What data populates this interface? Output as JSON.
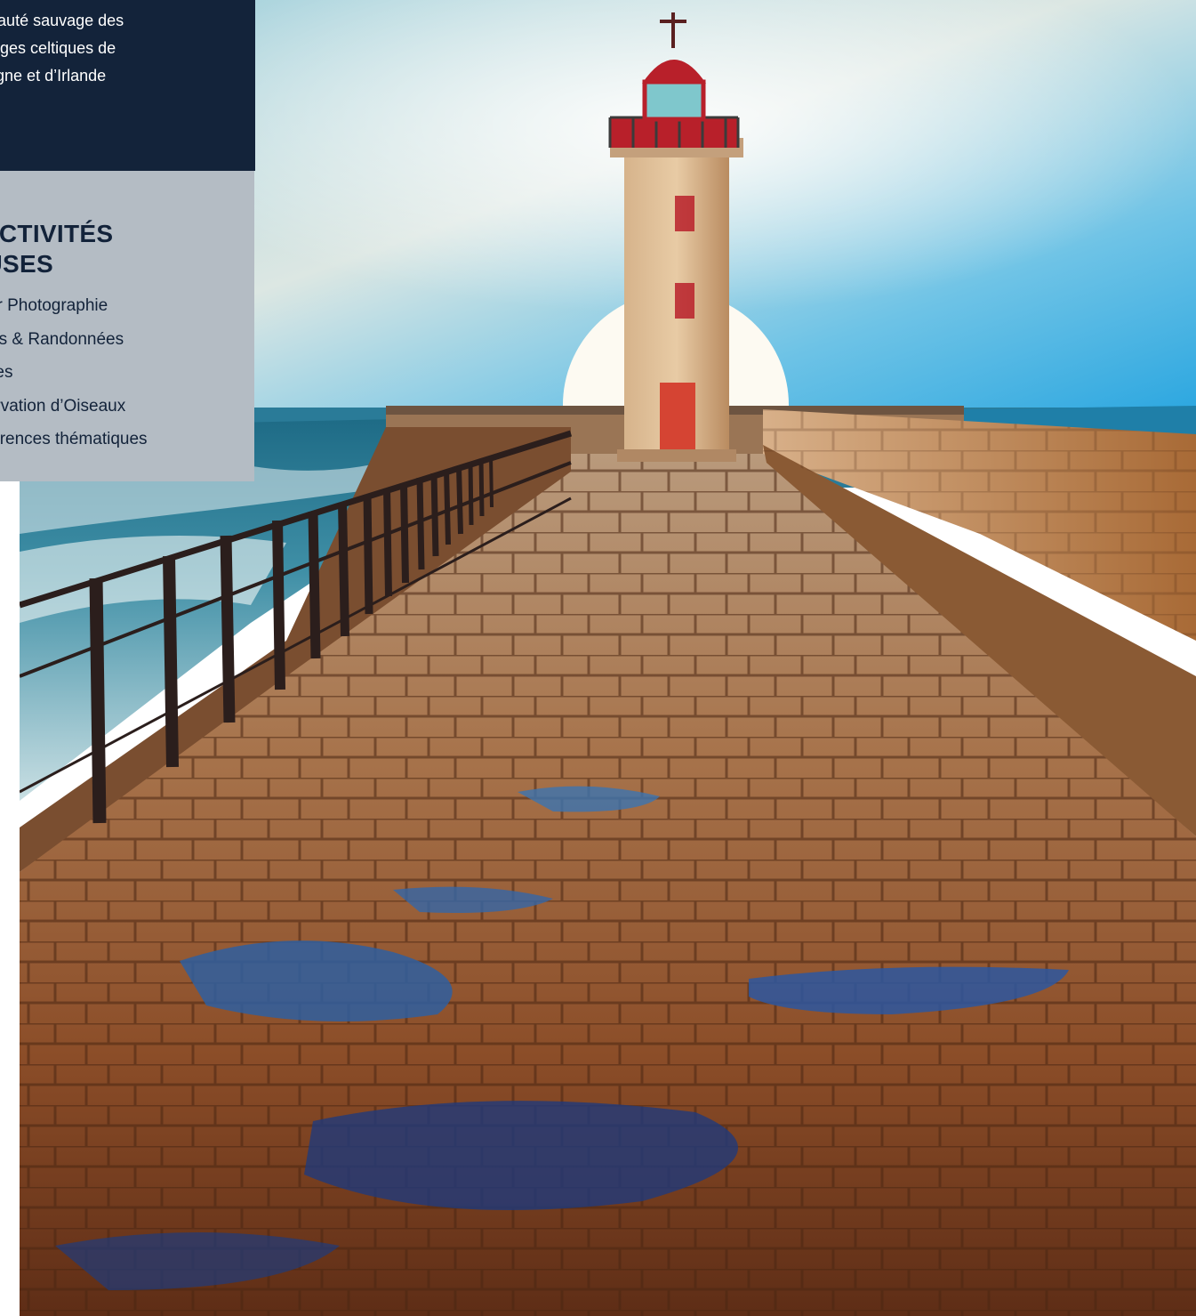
{
  "intro": {
    "lines": [
      "La beauté sauvage des",
      "paysages celtiques de",
      "Bretagne et d’Irlande"
    ]
  },
  "activities": {
    "heading_lines": [
      "LES ACTIVITÉS",
      "INCLUSES"
    ],
    "items": [
      "Atelier Photographie",
      "Sorties & Randonnées",
      "Veillées",
      "Observation d’Oiseaux",
      "Conférences thématiques"
    ]
  },
  "colors": {
    "panel_dark": "#13233a",
    "panel_light": "#b4bcc4",
    "lighthouse_red": "#b8202a"
  }
}
